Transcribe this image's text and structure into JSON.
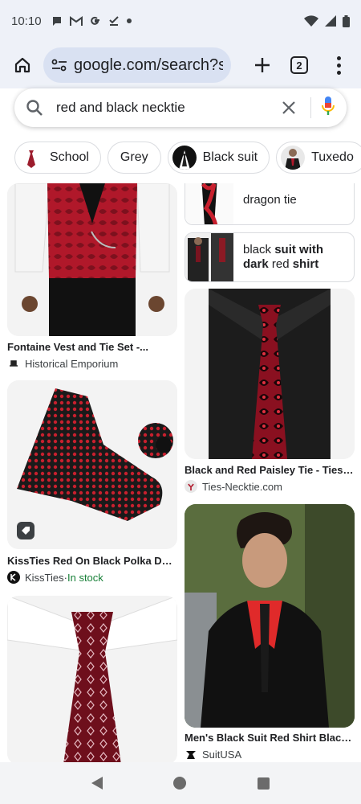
{
  "status_bar": {
    "time": "10:10",
    "left_icons": [
      "chat-icon",
      "gmail-icon",
      "google-icon",
      "download-done-icon",
      "dot-icon"
    ],
    "right_icons": [
      "wifi-icon",
      "signal-icon",
      "battery-icon"
    ]
  },
  "browser": {
    "url": "google.com/search?sca_",
    "tab_count": "2"
  },
  "search": {
    "query": "red and black necktie"
  },
  "chips": [
    {
      "label": "School",
      "has_thumb": true
    },
    {
      "label": "Grey",
      "has_thumb": false
    },
    {
      "label": "Black suit",
      "has_thumb": true
    },
    {
      "label": "Tuxedo",
      "has_thumb": true
    }
  ],
  "results": {
    "left": [
      {
        "title": "Fontaine Vest and Tie Set -...",
        "source": "Historical Emporium",
        "stock": ""
      },
      {
        "title": "KissTies Red On Black Polka Dot...",
        "source": "KissTies",
        "stock": "In stock"
      },
      {
        "title": "",
        "source": "",
        "stock": ""
      }
    ],
    "right_related": [
      {
        "plain1": "dragon tie",
        "bold1": "",
        "plain2": "",
        "bold2": ""
      },
      {
        "plain1": "black ",
        "bold1": "suit with dark",
        "plain2": " red ",
        "bold2": "shirt"
      }
    ],
    "right": [
      {
        "title": "Black and Red Paisley Tie - Ties-...",
        "source": "Ties-Necktie.com"
      },
      {
        "title": "Men's Black Suit Red Shirt Black...",
        "source": "SuitUSA"
      }
    ]
  },
  "stock_separator": " · ",
  "colors": {
    "accent_red": "#b0182a",
    "tie_dark": "#1a1a1a",
    "in_stock_green": "#188038"
  }
}
